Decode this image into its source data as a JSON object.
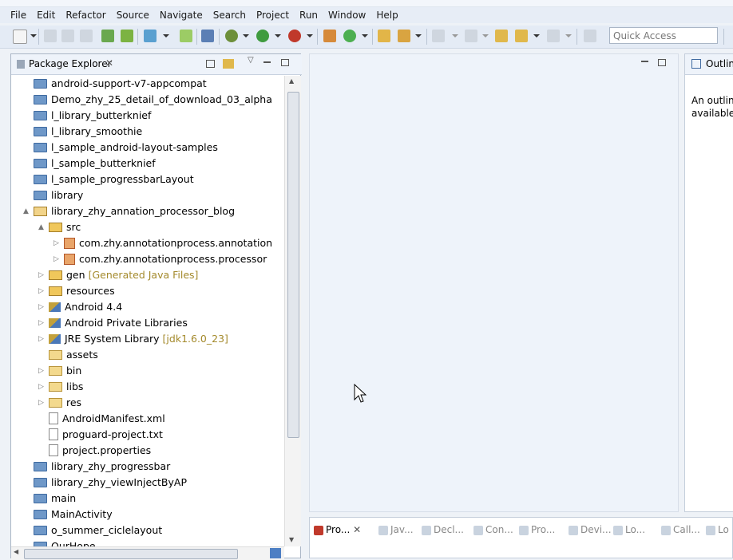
{
  "menu": [
    "File",
    "Edit",
    "Refactor",
    "Source",
    "Navigate",
    "Search",
    "Project",
    "Run",
    "Window",
    "Help"
  ],
  "quick_access": {
    "placeholder": "Quick Access"
  },
  "package_explorer": {
    "title": "Package Explorer",
    "items": [
      {
        "label": "android-support-v7-appcompat",
        "icon": "project-folder-icon",
        "indent": 0,
        "twisty": ""
      },
      {
        "label": "Demo_zhy_25_detail_of_download_03_alpha",
        "icon": "project-folder-icon",
        "indent": 0,
        "twisty": ""
      },
      {
        "label": "l_library_butterknief",
        "icon": "project-folder-icon",
        "indent": 0,
        "twisty": ""
      },
      {
        "label": "l_library_smoothie",
        "icon": "project-folder-icon",
        "indent": 0,
        "twisty": ""
      },
      {
        "label": "l_sample_android-layout-samples",
        "icon": "project-folder-icon",
        "indent": 0,
        "twisty": ""
      },
      {
        "label": "l_sample_butterknief",
        "icon": "project-folder-icon",
        "indent": 0,
        "twisty": ""
      },
      {
        "label": "l_sample_progressbarLayout",
        "icon": "project-folder-icon",
        "indent": 0,
        "twisty": ""
      },
      {
        "label": "library",
        "icon": "project-folder-icon",
        "indent": 0,
        "twisty": ""
      },
      {
        "label": "library_zhy_annation_processor_blog",
        "icon": "open-project-icon",
        "indent": 0,
        "twisty": "▲"
      },
      {
        "label": "src",
        "icon": "source-folder-icon",
        "indent": 1,
        "twisty": "▲"
      },
      {
        "label": "com.zhy.annotationprocess.annotation",
        "icon": "package-icon",
        "indent": 2,
        "twisty": "▷"
      },
      {
        "label": "com.zhy.annotationprocess.processor",
        "icon": "package-icon",
        "indent": 2,
        "twisty": "▷"
      },
      {
        "label": "gen",
        "icon": "source-folder-icon",
        "indent": 1,
        "twisty": "▷",
        "decoration": "[Generated Java Files]"
      },
      {
        "label": "resources",
        "icon": "source-folder-icon",
        "indent": 1,
        "twisty": "▷"
      },
      {
        "label": "Android 4.4",
        "icon": "library-icon",
        "indent": 1,
        "twisty": "▷"
      },
      {
        "label": "Android Private Libraries",
        "icon": "library-icon",
        "indent": 1,
        "twisty": "▷"
      },
      {
        "label": "JRE System Library",
        "icon": "library-icon",
        "indent": 1,
        "twisty": "▷",
        "decoration": "[jdk1.6.0_23]"
      },
      {
        "label": "assets",
        "icon": "folder-icon",
        "indent": 1,
        "twisty": ""
      },
      {
        "label": "bin",
        "icon": "folder-icon",
        "indent": 1,
        "twisty": "▷"
      },
      {
        "label": "libs",
        "icon": "folder-icon",
        "indent": 1,
        "twisty": "▷"
      },
      {
        "label": "res",
        "icon": "folder-icon",
        "indent": 1,
        "twisty": "▷"
      },
      {
        "label": "AndroidManifest.xml",
        "icon": "xml-file-icon",
        "indent": 1,
        "twisty": ""
      },
      {
        "label": "proguard-project.txt",
        "icon": "text-file-icon",
        "indent": 1,
        "twisty": ""
      },
      {
        "label": "project.properties",
        "icon": "text-file-icon",
        "indent": 1,
        "twisty": ""
      },
      {
        "label": "library_zhy_progressbar",
        "icon": "project-folder-icon",
        "indent": 0,
        "twisty": ""
      },
      {
        "label": "library_zhy_viewInjectByAP",
        "icon": "project-folder-icon",
        "indent": 0,
        "twisty": ""
      },
      {
        "label": "main",
        "icon": "project-folder-icon",
        "indent": 0,
        "twisty": ""
      },
      {
        "label": "MainActivity",
        "icon": "project-folder-icon",
        "indent": 0,
        "twisty": ""
      },
      {
        "label": "o_summer_ciclelayout",
        "icon": "project-folder-icon",
        "indent": 0,
        "twisty": ""
      },
      {
        "label": "OurHope",
        "icon": "project-folder-icon",
        "indent": 0,
        "twisty": ""
      }
    ]
  },
  "outline": {
    "title": "Outlin",
    "message": "An outlin available"
  },
  "bottom_tabs": [
    "Pro...",
    "Jav...",
    "Decl...",
    "Con...",
    "Pro...",
    "Devi...",
    "Lo...",
    "Call...",
    "Lo"
  ],
  "colors": {
    "accent": "#3f6aa0",
    "decoration": "#a48a2c"
  }
}
